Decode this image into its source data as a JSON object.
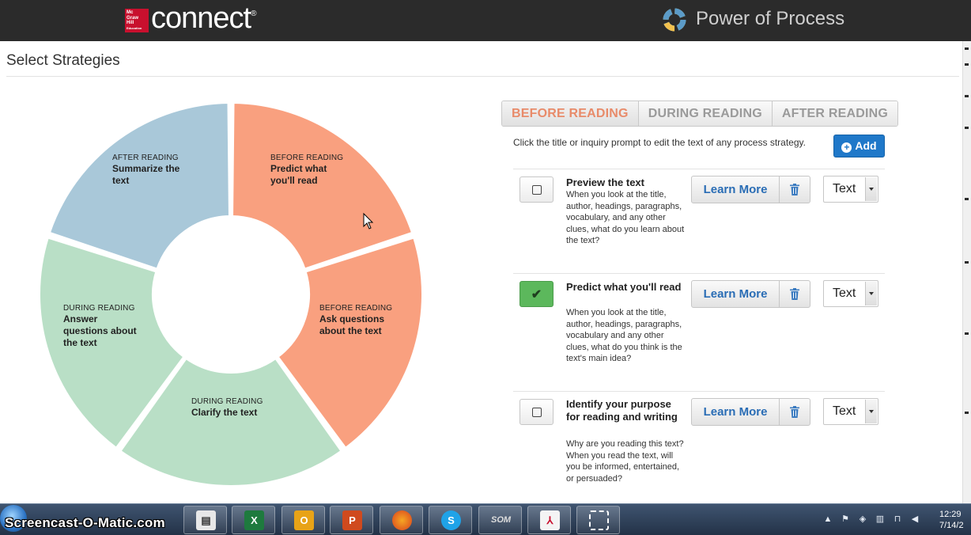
{
  "header": {
    "logo_lines": [
      "Mc",
      "Graw",
      "Hill",
      "Education"
    ],
    "app_name": "connect",
    "app_mark": "®",
    "product_title": "Power of Process"
  },
  "page": {
    "title": "Select Strategies"
  },
  "wheel": {
    "segments": [
      {
        "phase": "BEFORE READING",
        "name": "Predict what you'll read",
        "color": "#f9a07f"
      },
      {
        "phase": "BEFORE READING",
        "name": "Ask questions about the text",
        "color": "#f9a07f"
      },
      {
        "phase": "DURING READING",
        "name": "Clarify the text",
        "color": "#b9dfc6"
      },
      {
        "phase": "DURING READING",
        "name": "Answer questions about the text",
        "color": "#b9dfc6"
      },
      {
        "phase": "AFTER READING",
        "name": "Summarize the text",
        "color": "#a9c8d9"
      }
    ]
  },
  "tabs": [
    {
      "label": "BEFORE READING",
      "active": true
    },
    {
      "label": "DURING READING",
      "active": false
    },
    {
      "label": "AFTER READING",
      "active": false
    }
  ],
  "hint": "Click the title or inquiry prompt to edit the text of any process strategy.",
  "add_button": {
    "label": "Add"
  },
  "strategies": [
    {
      "checked": false,
      "title": "Preview the text",
      "description": "When you look at the title, author, headings, paragraphs, vocabulary, and any other clues, what do you learn about the text?",
      "learn_more": "Learn More",
      "type": "Text"
    },
    {
      "checked": true,
      "title": "Predict what you'll read",
      "description": "When you look at the title, author, headings, paragraphs, vocabulary and any other clues, what do you think is the text's main idea?",
      "learn_more": "Learn More",
      "type": "Text"
    },
    {
      "checked": false,
      "title": "Identify your purpose for reading and writing",
      "description": "Why are you reading this text? When you read the text, will you be informed, entertained, or persuaded?",
      "learn_more": "Learn More",
      "type": "Text"
    }
  ],
  "taskbar": {
    "watermark": "Screencast-O-Matic.com",
    "apps": [
      "document",
      "excel",
      "outlook",
      "powerpoint",
      "firefox",
      "skype",
      "som",
      "acrobat",
      "snipping-tool"
    ],
    "clock_time": "12:29",
    "clock_date": "7/14/2"
  },
  "colors": {
    "accent_active_tab": "#e88b6a",
    "add_button": "#1f78c9",
    "check_on": "#5cb85c"
  }
}
